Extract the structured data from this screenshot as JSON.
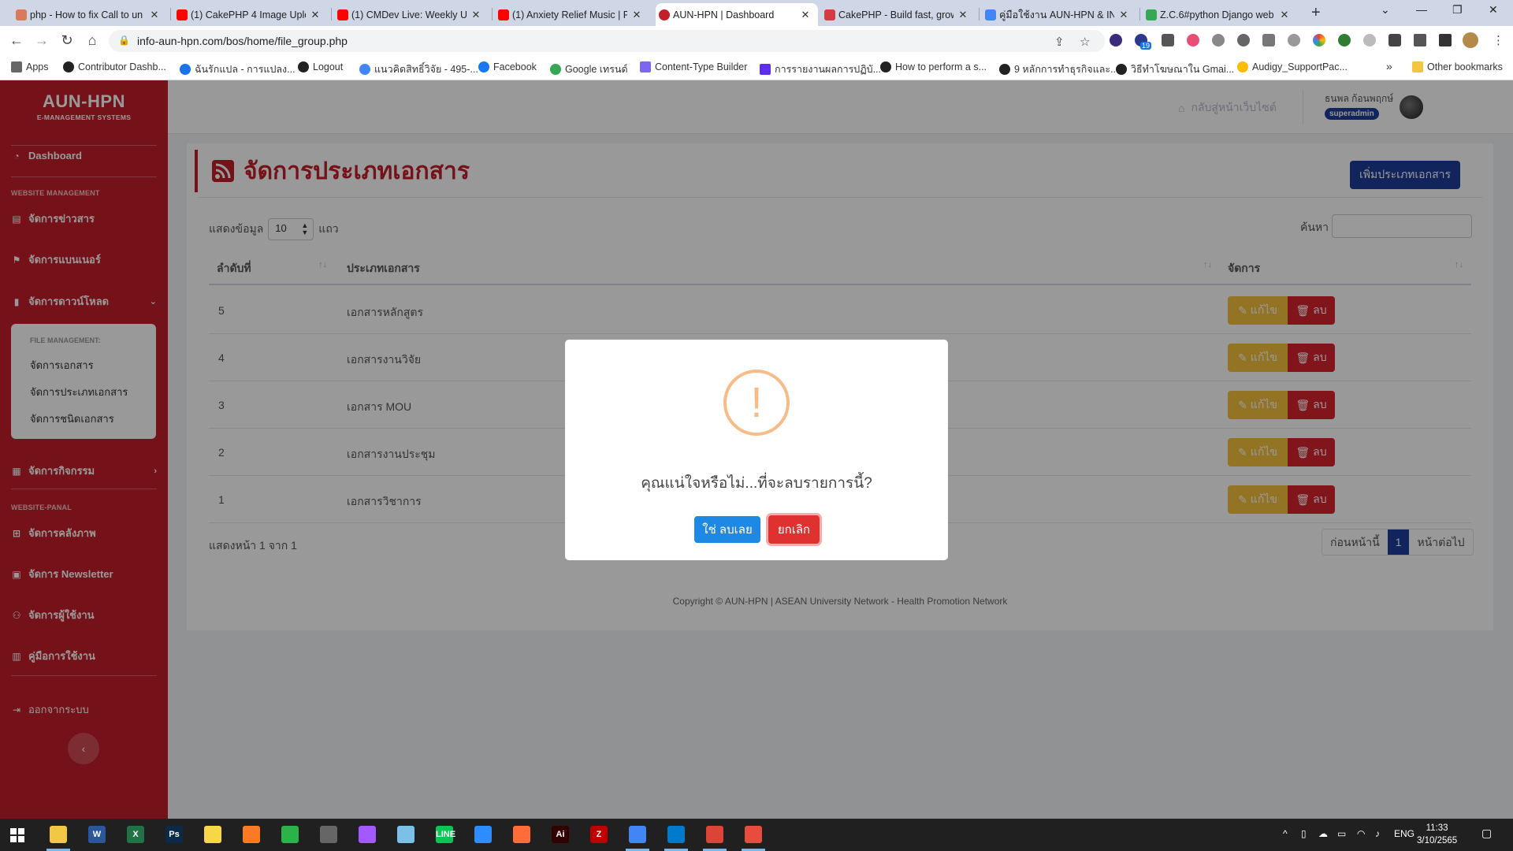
{
  "browser": {
    "tabs": [
      {
        "title": "php - How to fix Call to un",
        "close": "✕",
        "color": "#d87b5a"
      },
      {
        "title": "(1) CakePHP 4 Image Uplo",
        "close": "✕",
        "color": "#ff0000"
      },
      {
        "title": "(1) CMDev Live: Weekly Up",
        "close": "✕",
        "color": "#ff0000"
      },
      {
        "title": "(1) Anxiety Relief Music | F",
        "close": "✕",
        "color": "#ff0000"
      },
      {
        "title": "AUN-HPN | Dashboard",
        "close": "✕",
        "color": "#c41e2a"
      },
      {
        "title": "CakePHP - Build fast, grow",
        "close": "✕",
        "color": "#d33c43"
      },
      {
        "title": "คู่มือใช้งาน AUN-HPN & INF",
        "close": "✕",
        "color": "#4285f4"
      },
      {
        "title": "Z.C.6#python Django web",
        "close": "✕",
        "color": "#34a853"
      }
    ],
    "new_tab": "+",
    "window_controls": {
      "dropdown": "⌄",
      "minimize": "—",
      "restore": "❐",
      "close": "✕"
    },
    "url": "info-aun-hpn.com/bos/home/file_group.php",
    "nav": {
      "back": "←",
      "forward": "→",
      "reload": "↻",
      "home": "⌂"
    },
    "ext_badge": "19",
    "bookmarks": [
      {
        "label": "Apps",
        "color": "#666"
      },
      {
        "label": "Contributor Dashb...",
        "color": "#222"
      },
      {
        "label": "ฉันรักแปล - การแปลง...",
        "color": "#1a73e8"
      },
      {
        "label": "Logout",
        "color": "#222"
      },
      {
        "label": "แนวคิดสิทธิ์วิจัย - 495-...",
        "color": "#4285f4"
      },
      {
        "label": "Facebook",
        "color": "#1877f2"
      },
      {
        "label": "Google เทรนด์",
        "color": "#34a853"
      },
      {
        "label": "Content-Type Builder",
        "color": "#7b68ee"
      },
      {
        "label": "การรายงานผลการปฏิบั...",
        "color": "#5f2eea"
      },
      {
        "label": "How to perform a s...",
        "color": "#222"
      },
      {
        "label": "9 หลักการทำธุรกิจและ...",
        "color": "#222"
      },
      {
        "label": "วิธีทำโฆษณาใน Gmai...",
        "color": "#222"
      },
      {
        "label": "Audigy_SupportPac...",
        "color": "#fbbc04"
      }
    ],
    "bookmarks_more": "»",
    "other_bookmarks": "Other bookmarks"
  },
  "sidebar": {
    "brand": "AUN-HPN",
    "brand_sub": "E-MANAGEMENT SYSTEMS",
    "dashboard": "Dashboard",
    "section_website": "WEBSITE MANAGEMENT",
    "news": "จัดการข่าวสาร",
    "banner": "จัดการแบนเนอร์",
    "download": "จัดการดาวน์โหลด",
    "submenu_head": "FILE MANAGEMENT:",
    "submenu": [
      "จัดการเอกสาร",
      "จัดการประเภทเอกสาร",
      "จัดการชนิดเอกสาร"
    ],
    "activity": "จัดการกิจกรรม",
    "section_panel": "WEBSITE-PANAL",
    "gallery": "จัดการคลังภาพ",
    "newsletter": "จัดการ Newsletter",
    "users": "จัดการผู้ใช้งาน",
    "manual": "คู่มือการใช้งาน",
    "logout": "ออกจากระบบ",
    "collapse": "‹"
  },
  "topbar": {
    "back_site": "กลับสู่หน้าเว็บไซต์",
    "user_name": "ธนพล ก้อนพฤกษ์",
    "user_role": "superadmin"
  },
  "page": {
    "title": "จัดการประเภทเอกสาร",
    "add_button": "เพิ่มประเภทเอกสาร",
    "show_label": "แสดงข้อมูล",
    "page_size": "10",
    "rows_label": "แถว",
    "search_label": "ค้นหา",
    "columns": [
      "ลำดับที่",
      "ประเภทเอกสาร",
      "จัดการ"
    ],
    "rows": [
      {
        "no": "5",
        "name": "เอกสารหลักสูตร"
      },
      {
        "no": "4",
        "name": "เอกสารงานวิจัย"
      },
      {
        "no": "3",
        "name": "เอกสาร MOU"
      },
      {
        "no": "2",
        "name": "เอกสารงานประชุม"
      },
      {
        "no": "1",
        "name": "เอกสารวิชาการ"
      }
    ],
    "edit_label": "แก้ไข",
    "delete_label": "ลบ",
    "info": "แสดงหน้า 1 จาก 1",
    "pager": {
      "prev": "ก่อนหน้านี้",
      "current": "1",
      "next": "หน้าต่อไป"
    },
    "footer": "Copyright © AUN-HPN | ASEAN University Network - Health Promotion Network"
  },
  "modal": {
    "icon": "!",
    "message": "คุณแน่ใจหรือไม่...ที่จะลบรายการนี้?",
    "confirm": "ใช่ ลบเลย",
    "cancel": "ยกเลิก"
  },
  "taskbar": {
    "apps": [
      {
        "name": "file-explorer",
        "label": "",
        "color": "#f2c744"
      },
      {
        "name": "word",
        "label": "W",
        "color": "#2b579a"
      },
      {
        "name": "excel",
        "label": "X",
        "color": "#217346"
      },
      {
        "name": "photoshop",
        "label": "Ps",
        "color": "#0b2a4a"
      },
      {
        "name": "sticky-notes",
        "label": "",
        "color": "#f7d748"
      },
      {
        "name": "xampp",
        "label": "",
        "color": "#fb7a24"
      },
      {
        "name": "chat",
        "label": "",
        "color": "#2bb34a"
      },
      {
        "name": "calculator",
        "label": "",
        "color": "#666"
      },
      {
        "name": "figma",
        "label": "",
        "color": "#a259ff"
      },
      {
        "name": "notepad",
        "label": "",
        "color": "#7cc0e8"
      },
      {
        "name": "line",
        "label": "LINE",
        "color": "#06c755"
      },
      {
        "name": "zoom",
        "label": "",
        "color": "#2d8cff"
      },
      {
        "name": "postman",
        "label": "",
        "color": "#ff6c37"
      },
      {
        "name": "illustrator",
        "label": "Ai",
        "color": "#330000"
      },
      {
        "name": "filezilla",
        "label": "Z",
        "color": "#bf0000"
      },
      {
        "name": "chrome",
        "label": "",
        "color": "#4285f4"
      },
      {
        "name": "vscode",
        "label": "",
        "color": "#007acc"
      },
      {
        "name": "chrome-active",
        "label": "",
        "color": "#db4437"
      },
      {
        "name": "app-other",
        "label": "",
        "color": "#e74c3c"
      }
    ],
    "lang": "ENG",
    "time": "11:33",
    "date": "3/10/2565"
  }
}
